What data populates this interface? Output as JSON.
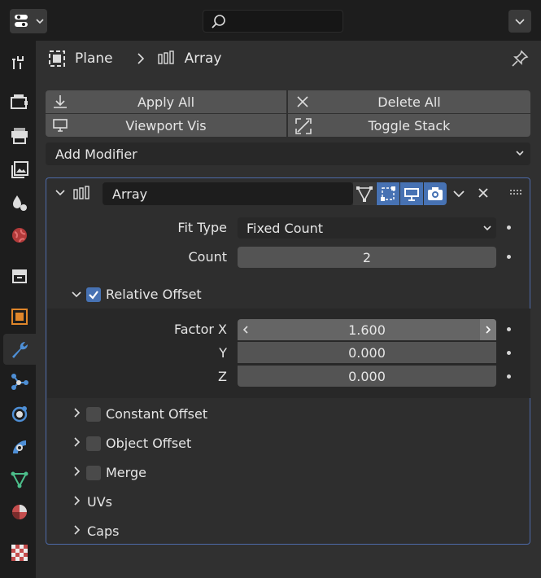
{
  "header": {
    "editor_type_icon": "properties-editor-icon",
    "search_placeholder": ""
  },
  "tabs": [
    {
      "name": "tool",
      "icon": "tool-icon"
    },
    {
      "name": "render",
      "icon": "render-icon"
    },
    {
      "name": "output",
      "icon": "output-icon"
    },
    {
      "name": "view-layer",
      "icon": "view-layer-icon"
    },
    {
      "name": "scene",
      "icon": "scene-icon"
    },
    {
      "name": "world",
      "icon": "world-icon"
    },
    {
      "name": "collection",
      "icon": "collection-icon"
    },
    {
      "name": "object",
      "icon": "object-icon"
    },
    {
      "name": "modifiers",
      "icon": "wrench-icon",
      "active": true
    },
    {
      "name": "particles",
      "icon": "particles-icon"
    },
    {
      "name": "physics",
      "icon": "physics-icon"
    },
    {
      "name": "constraints",
      "icon": "constraints-icon"
    },
    {
      "name": "data",
      "icon": "mesh-data-icon"
    },
    {
      "name": "material",
      "icon": "material-icon"
    },
    {
      "name": "texture",
      "icon": "texture-icon"
    }
  ],
  "breadcrumb": {
    "object": "Plane",
    "modifier": "Array"
  },
  "toolbar": {
    "apply_all": "Apply All",
    "delete_all": "Delete All",
    "viewport_vis": "Viewport Vis",
    "toggle_stack": "Toggle Stack"
  },
  "add_modifier": "Add Modifier",
  "modifier": {
    "name": "Array",
    "fit_type_label": "Fit Type",
    "fit_type_value": "Fixed Count",
    "count_label": "Count",
    "count_value": "2",
    "relative_offset": {
      "label": "Relative Offset",
      "enabled": true,
      "factor_x_label": "Factor X",
      "factor_x": "1.600",
      "y_label": "Y",
      "y": "0.000",
      "z_label": "Z",
      "z": "0.000"
    },
    "sections": [
      {
        "label": "Constant Offset",
        "checkbox": true,
        "checked": false
      },
      {
        "label": "Object Offset",
        "checkbox": true,
        "checked": false
      },
      {
        "label": "Merge",
        "checkbox": true,
        "checked": false
      },
      {
        "label": "UVs",
        "checkbox": false
      },
      {
        "label": "Caps",
        "checkbox": false
      }
    ]
  },
  "colors": {
    "accent": "#4772b3",
    "panel": "#303030",
    "field": "#545454",
    "background": "#1d1d1d"
  }
}
